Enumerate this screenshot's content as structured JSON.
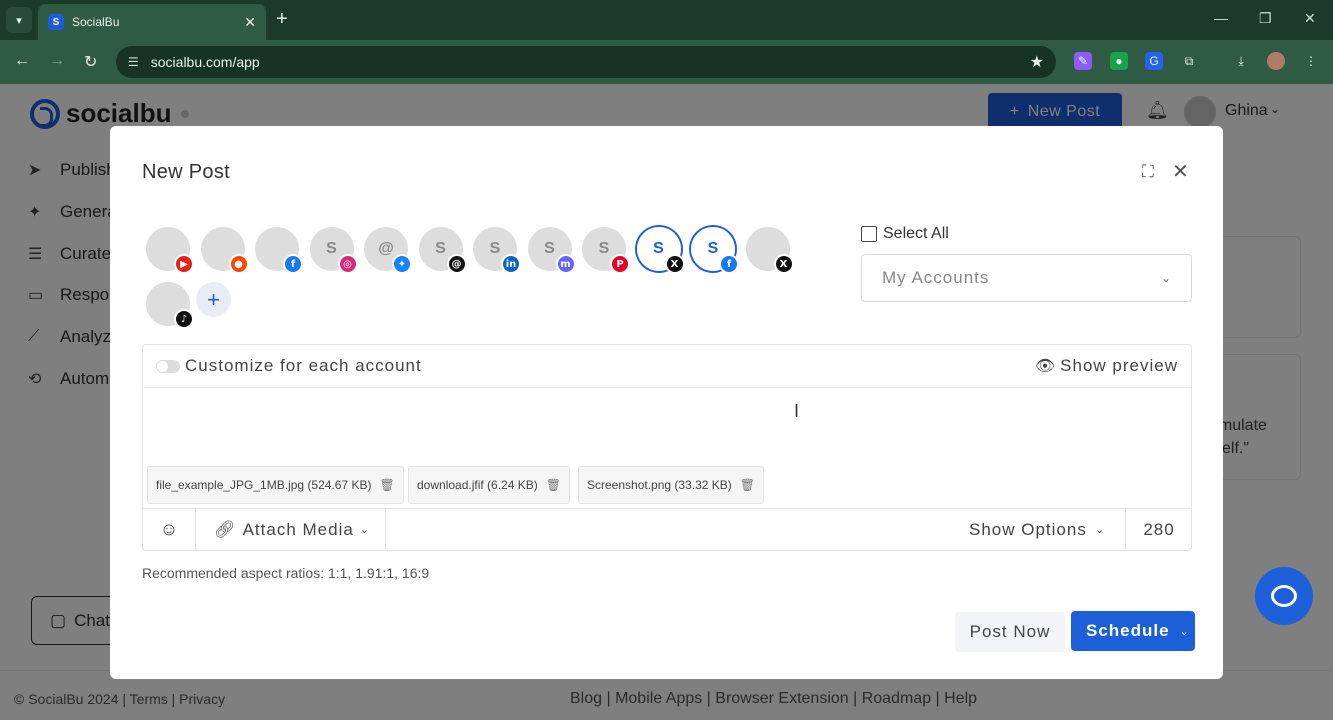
{
  "browser": {
    "tab_title": "SocialBu",
    "url": "socialbu.com/app"
  },
  "app": {
    "brand": "socialbu",
    "new_post_label": "New Post",
    "user_name": "Ghina",
    "sidebar": [
      {
        "label": "Publish",
        "icon": "send-icon"
      },
      {
        "label": "Generate",
        "icon": "sparkle-icon"
      },
      {
        "label": "Curate",
        "icon": "list-search-icon"
      },
      {
        "label": "Respond",
        "icon": "message-icon"
      },
      {
        "label": "Analyze",
        "icon": "chart-icon"
      },
      {
        "label": "Automate",
        "icon": "repeat-icon"
      }
    ],
    "chat_label": "Chat",
    "bg_card_text_1": "emulate",
    "bg_card_text_2": "self.\"",
    "footer_left": "© SocialBu 2024 | Terms | Privacy",
    "footer_links": "Blog | Mobile Apps | Browser Extension | Roadmap | Help"
  },
  "modal": {
    "title": "New Post",
    "accounts": [
      {
        "initial": "",
        "network": "youtube",
        "badge": "▶",
        "color": "#e62117",
        "selected": false
      },
      {
        "initial": "",
        "network": "reddit",
        "badge": "●",
        "color": "#ff4500",
        "selected": false
      },
      {
        "initial": "",
        "network": "facebook",
        "badge": "f",
        "color": "#1877f2",
        "selected": false
      },
      {
        "initial": "S",
        "network": "instagram",
        "badge": "◎",
        "color": "#d62976",
        "selected": false
      },
      {
        "initial": "@",
        "network": "bluesky",
        "badge": "✦",
        "color": "#1185fe",
        "selected": false
      },
      {
        "initial": "S",
        "network": "threads",
        "badge": "@",
        "color": "#111111",
        "selected": false
      },
      {
        "initial": "S",
        "network": "linkedin",
        "badge": "in",
        "color": "#0a66c2",
        "selected": false
      },
      {
        "initial": "S",
        "network": "mastodon",
        "badge": "m",
        "color": "#6364ff",
        "selected": false
      },
      {
        "initial": "S",
        "network": "pinterest",
        "badge": "P",
        "color": "#e60023",
        "selected": false
      },
      {
        "initial": "S",
        "network": "x",
        "badge": "X",
        "color": "#111111",
        "selected": true
      },
      {
        "initial": "S",
        "network": "facebook",
        "badge": "f",
        "color": "#1877f2",
        "selected": true
      },
      {
        "initial": "",
        "network": "x",
        "badge": "X",
        "color": "#111111",
        "selected": false
      },
      {
        "initial": "",
        "network": "tiktok",
        "badge": "♪",
        "color": "#111111",
        "selected": false
      }
    ],
    "select_all_label": "Select All",
    "accounts_dropdown_placeholder": "My Accounts",
    "customize_label": "Customize for each account",
    "show_preview_label": "Show preview",
    "files": [
      {
        "name": "file_example_JPG_1MB.jpg (524.67 KB)"
      },
      {
        "name": "download.jfif (6.24 KB)"
      },
      {
        "name": "Screenshot.png (33.32 KB)"
      }
    ],
    "attach_media_label": "Attach Media",
    "show_options_label": "Show Options",
    "char_count": "280",
    "aspect_note": "Recommended aspect ratios: 1:1, 1.91:1, 16:9",
    "post_now_label": "Post Now",
    "schedule_label": "Schedule"
  },
  "colors": {
    "brand_blue": "#1d5fd8",
    "browser_frame": "#2f5a43"
  }
}
